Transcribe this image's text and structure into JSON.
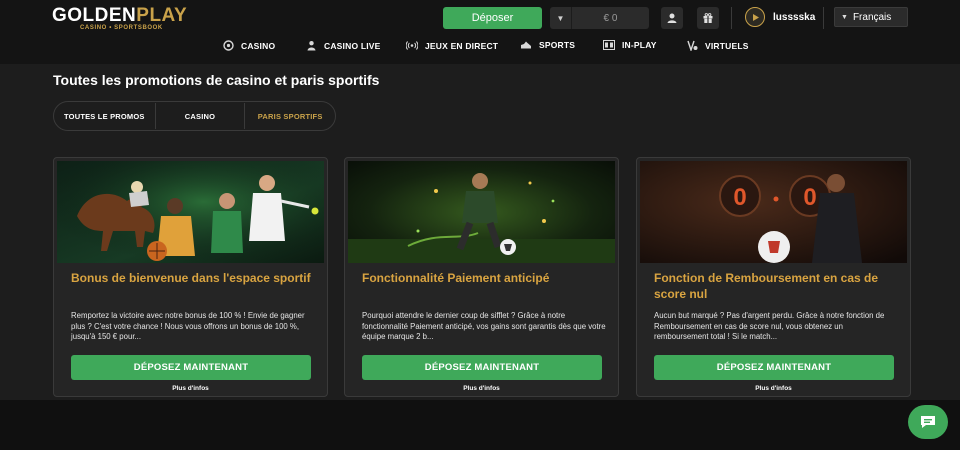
{
  "header": {
    "logo_main_a": "GOLDEN",
    "logo_main_b": "PLAY",
    "logo_sub": "CASINO • SPORTSBOOK",
    "deposit_label": "Déposer",
    "balance": "€ 0",
    "username": "lusssska",
    "language": "Français"
  },
  "nav": {
    "items": [
      {
        "label": "CASINO",
        "icon": "casino-chip-icon"
      },
      {
        "label": "CASINO LIVE",
        "icon": "dealer-icon"
      },
      {
        "label": "JEUX EN DIRECT",
        "icon": "broadcast-icon"
      },
      {
        "label": "SPORTS",
        "icon": "sneaker-icon"
      },
      {
        "label": "IN-PLAY",
        "icon": "scoreboard-icon"
      },
      {
        "label": "VIRTUELS",
        "icon": "virtual-icon"
      }
    ]
  },
  "page": {
    "title": "Toutes les promotions de casino et paris sportifs",
    "filters": [
      "TOUTES LE PROMOS",
      "CASINO",
      "PARIS SPORTIFS"
    ],
    "active_filter": "PARIS SPORTIFS"
  },
  "cards": [
    {
      "title": "Bonus de bienvenue dans l'espace sportif",
      "description": "Remportez la victoire avec notre bonus de 100 % ! Envie de gagner plus ? C'est votre chance ! Nous vous offrons un bonus de 100 %, jusqu'à 150 € pour...",
      "button": "DÉPOSEZ MAINTENANT",
      "more": "Plus d'infos"
    },
    {
      "title": "Fonctionnalité Paiement anticipé",
      "description": "Pourquoi attendre le dernier coup de sifflet ? Grâce à notre fonctionnalité Paiement anticipé, vos gains sont garantis dès que votre équipe marque 2 b...",
      "button": "DÉPOSEZ MAINTENANT",
      "more": "Plus d'infos"
    },
    {
      "title": "Fonction de Remboursement en cas de score nul",
      "description": "Aucun but marqué ? Pas d'argent perdu. Grâce à notre fonction de Remboursement en cas de score nul, vous obtenez un remboursement total ! Si le match...",
      "button": "DÉPOSEZ MAINTENANT",
      "more": "Plus d'infos",
      "scoreboard": [
        "0",
        "0"
      ]
    }
  ],
  "colors": {
    "accent_green": "#3fa95a",
    "gold": "#d9a441",
    "background": "#1d1d1d"
  }
}
